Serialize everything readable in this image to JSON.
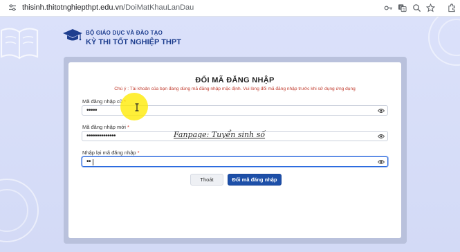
{
  "browser": {
    "url_host": "thisinh.thitotnghiepthpt.edu.vn",
    "url_path": "/DoiMatKhauLanDau"
  },
  "header": {
    "org_name": "BỘ GIÁO DỤC VÀ ĐÀO TẠO",
    "exam_name": "KỲ THI TỐT NGHIỆP THPT"
  },
  "form": {
    "title": "ĐỔI MÃ ĐĂNG NHẬP",
    "note": "Chú ý : Tài khoản của bạn đang dùng mã đăng nhập mặc định. Vui lòng đổi mã đăng nhập trước khi sử dụng ứng dụng",
    "fields": [
      {
        "label": "Mã đăng nhập cũ",
        "required": "*",
        "value": "•••••"
      },
      {
        "label": "Mã đăng nhập mới",
        "required": "*",
        "value": "••••••••••••••"
      },
      {
        "label": "Nhập lại mã đăng nhập",
        "required": "*",
        "value": "••"
      }
    ],
    "watermark": "Fanpage: Tuyển sinh số",
    "buttons": {
      "exit": "Thoát",
      "submit": "Đổi mã đăng nhập"
    }
  },
  "colors": {
    "brand": "#1f3f8f",
    "primary_button": "#1d4fa8",
    "note_red": "#c0392b",
    "focus_border": "#2d6cdf"
  },
  "icons": [
    "site-settings-icon",
    "key-icon",
    "translate-icon",
    "zoom-icon",
    "star-icon",
    "extensions-icon",
    "eye-icon",
    "graduation-cap-logo"
  ]
}
